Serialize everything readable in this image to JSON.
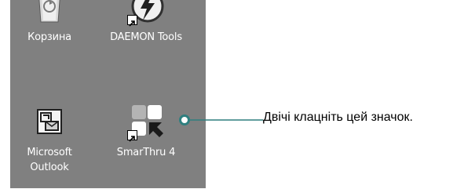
{
  "desktop": {
    "background": "#808080",
    "icons": [
      {
        "label": "Корзина",
        "icon": "recycle-bin-icon"
      },
      {
        "label": "DAEMON Tools",
        "icon": "daemon-tools-icon"
      },
      {
        "label": "Microsoft\nOutlook",
        "icon": "outlook-icon"
      },
      {
        "label": "SmarThru 4",
        "icon": "smarthru-icon"
      }
    ]
  },
  "callout": {
    "text": "Двічі клацніть цей значок.",
    "line_color": "#2f7f7f"
  }
}
